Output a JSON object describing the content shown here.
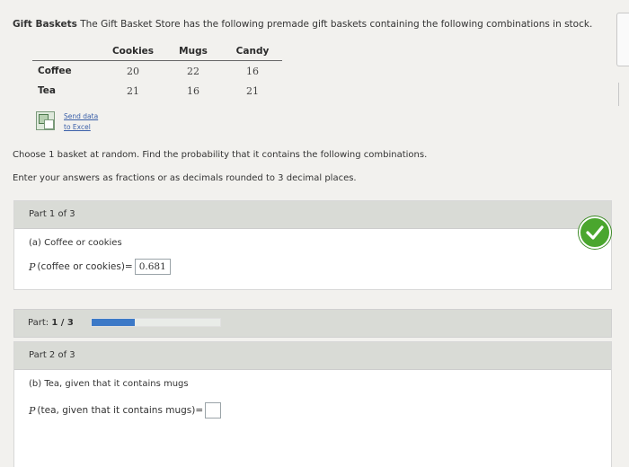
{
  "problem": {
    "title": "Gift Baskets",
    "text": "The Gift Basket Store has the following premade gift baskets containing the following combinations in stock."
  },
  "table": {
    "columns": [
      "Cookies",
      "Mugs",
      "Candy"
    ],
    "rows": [
      {
        "label": "Coffee",
        "values": [
          "20",
          "22",
          "16"
        ]
      },
      {
        "label": "Tea",
        "values": [
          "21",
          "16",
          "21"
        ]
      }
    ]
  },
  "excel": {
    "line1": "Send data",
    "line2": "to Excel",
    "icon": "excel-icon"
  },
  "instructions": {
    "line1": "Choose 1 basket at random. Find the probability that it contains the following combinations.",
    "line2": "Enter your answers as fractions or as decimals rounded to 3 decimal places."
  },
  "part1": {
    "header": "Part 1 of 3",
    "question": "(a) Coffee or cookies",
    "P": "P",
    "expression": "(coffee or cookies)",
    "equals": "=",
    "answer": "0.681",
    "status_icon": "checkmark-icon",
    "status_color": "#4aa62e"
  },
  "progress": {
    "label": "Part:",
    "value": "1 / 3",
    "fraction": 0.333
  },
  "part2": {
    "header": "Part 2 of 3",
    "question": "(b) Tea, given that it contains mugs",
    "P": "P",
    "expression": "(tea, given that it contains mugs)",
    "equals": "=",
    "answer": ""
  }
}
